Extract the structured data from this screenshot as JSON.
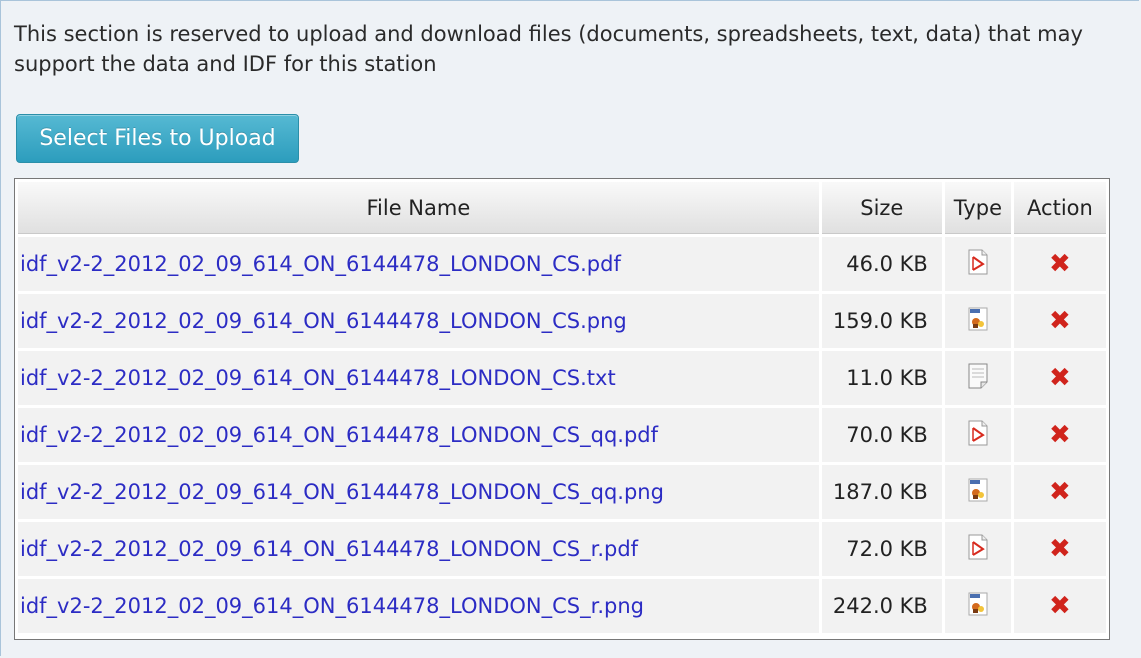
{
  "intro_text": "This section is reserved to upload and download files (documents, spreadsheets, text, data) that may support the data and IDF for this station",
  "upload_button_label": "Select Files to Upload",
  "table": {
    "headers": {
      "file_name": "File Name",
      "size": "Size",
      "type": "Type",
      "action": "Action"
    },
    "rows": [
      {
        "name": "idf_v2-2_2012_02_09_614_ON_6144478_LONDON_CS.pdf",
        "size": "46.0 KB",
        "type_icon": "pdf-icon"
      },
      {
        "name": "idf_v2-2_2012_02_09_614_ON_6144478_LONDON_CS.png",
        "size": "159.0 KB",
        "type_icon": "image-icon"
      },
      {
        "name": "idf_v2-2_2012_02_09_614_ON_6144478_LONDON_CS.txt",
        "size": "11.0 KB",
        "type_icon": "text-file-icon"
      },
      {
        "name": "idf_v2-2_2012_02_09_614_ON_6144478_LONDON_CS_qq.pdf",
        "size": "70.0 KB",
        "type_icon": "pdf-icon"
      },
      {
        "name": "idf_v2-2_2012_02_09_614_ON_6144478_LONDON_CS_qq.png",
        "size": "187.0 KB",
        "type_icon": "image-icon"
      },
      {
        "name": "idf_v2-2_2012_02_09_614_ON_6144478_LONDON_CS_r.pdf",
        "size": "72.0 KB",
        "type_icon": "pdf-icon"
      },
      {
        "name": "idf_v2-2_2012_02_09_614_ON_6144478_LONDON_CS_r.png",
        "size": "242.0 KB",
        "type_icon": "image-icon"
      }
    ]
  },
  "colors": {
    "link": "#2c2cc4",
    "button": "#2c9dbd",
    "delete": "#d0241c"
  }
}
